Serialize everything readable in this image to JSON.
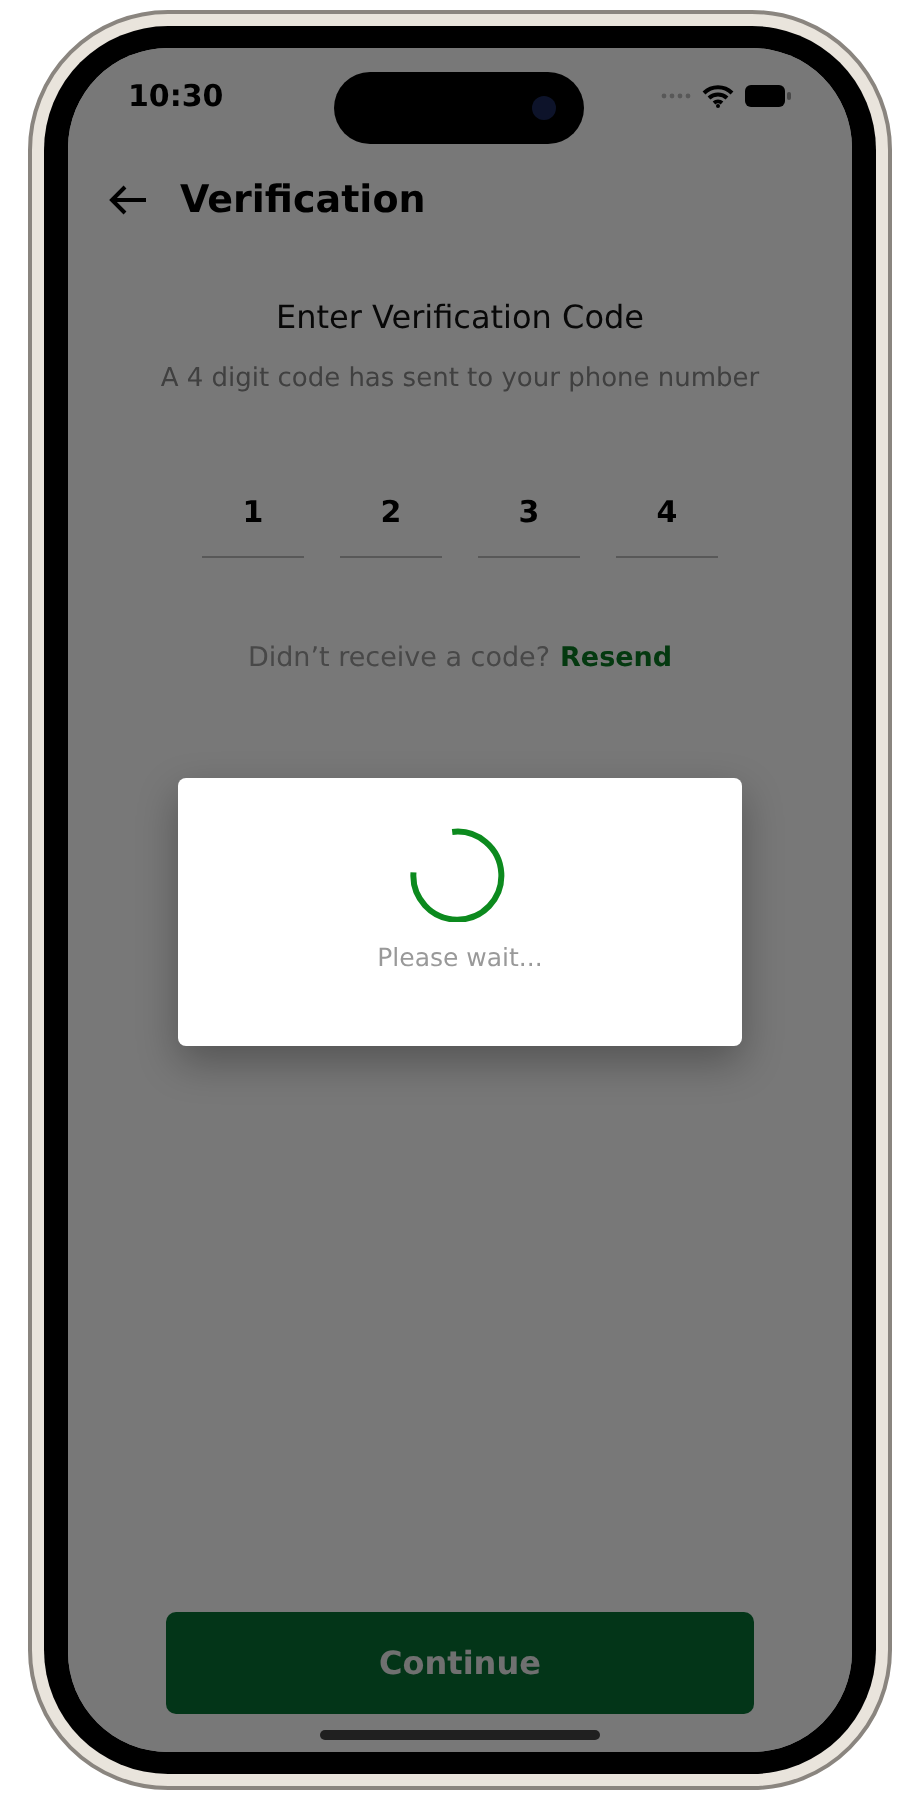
{
  "status_bar": {
    "time": "10:30"
  },
  "header": {
    "title": "Verification"
  },
  "heading": "Enter Verification Code",
  "subtitle": "A 4 digit code has sent to your phone number",
  "code_digits": [
    "1",
    "2",
    "3",
    "4"
  ],
  "resend": {
    "prompt": "Didn’t receive a code?",
    "link": "Resend"
  },
  "loading_dialog": {
    "message": "Please wait..."
  },
  "continue_button": "Continue"
}
